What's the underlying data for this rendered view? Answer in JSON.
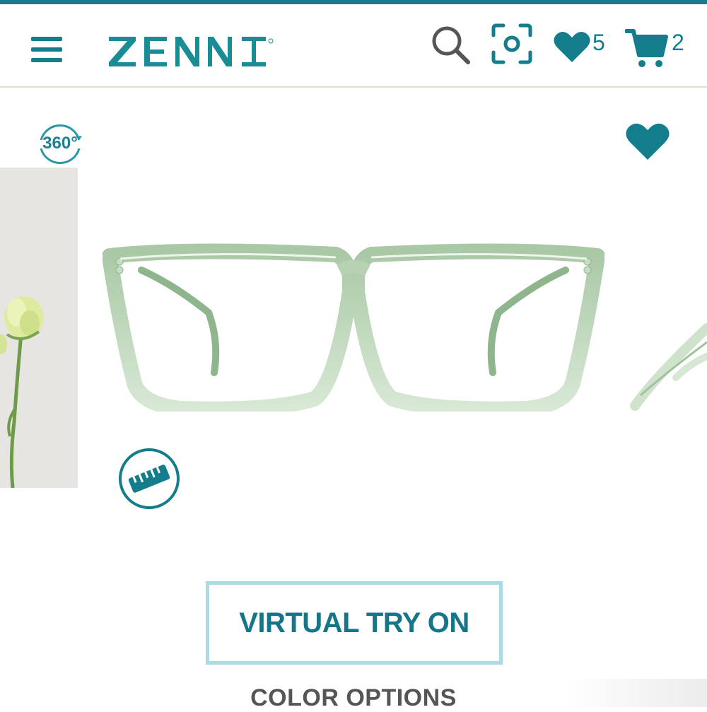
{
  "header": {
    "brand": "ZENNI",
    "menu_icon": "hamburger-menu-icon",
    "search_icon": "search-icon",
    "scan_icon": "face-scan-icon",
    "favorites_icon": "heart-icon",
    "favorites_count": "5",
    "cart_icon": "cart-icon",
    "cart_count": "2"
  },
  "product": {
    "view_360_label": "360°",
    "favorite_icon": "heart-icon",
    "measure_icon": "ruler-icon",
    "frame_color": "#cfe2cf"
  },
  "actions": {
    "virtual_try_on": "VIRTUAL TRY ON"
  },
  "sections": {
    "color_options": "COLOR OPTIONS"
  },
  "colors": {
    "brand": "#137d8c",
    "cta_text": "#157689",
    "cta_border": "#a9dbe3"
  }
}
